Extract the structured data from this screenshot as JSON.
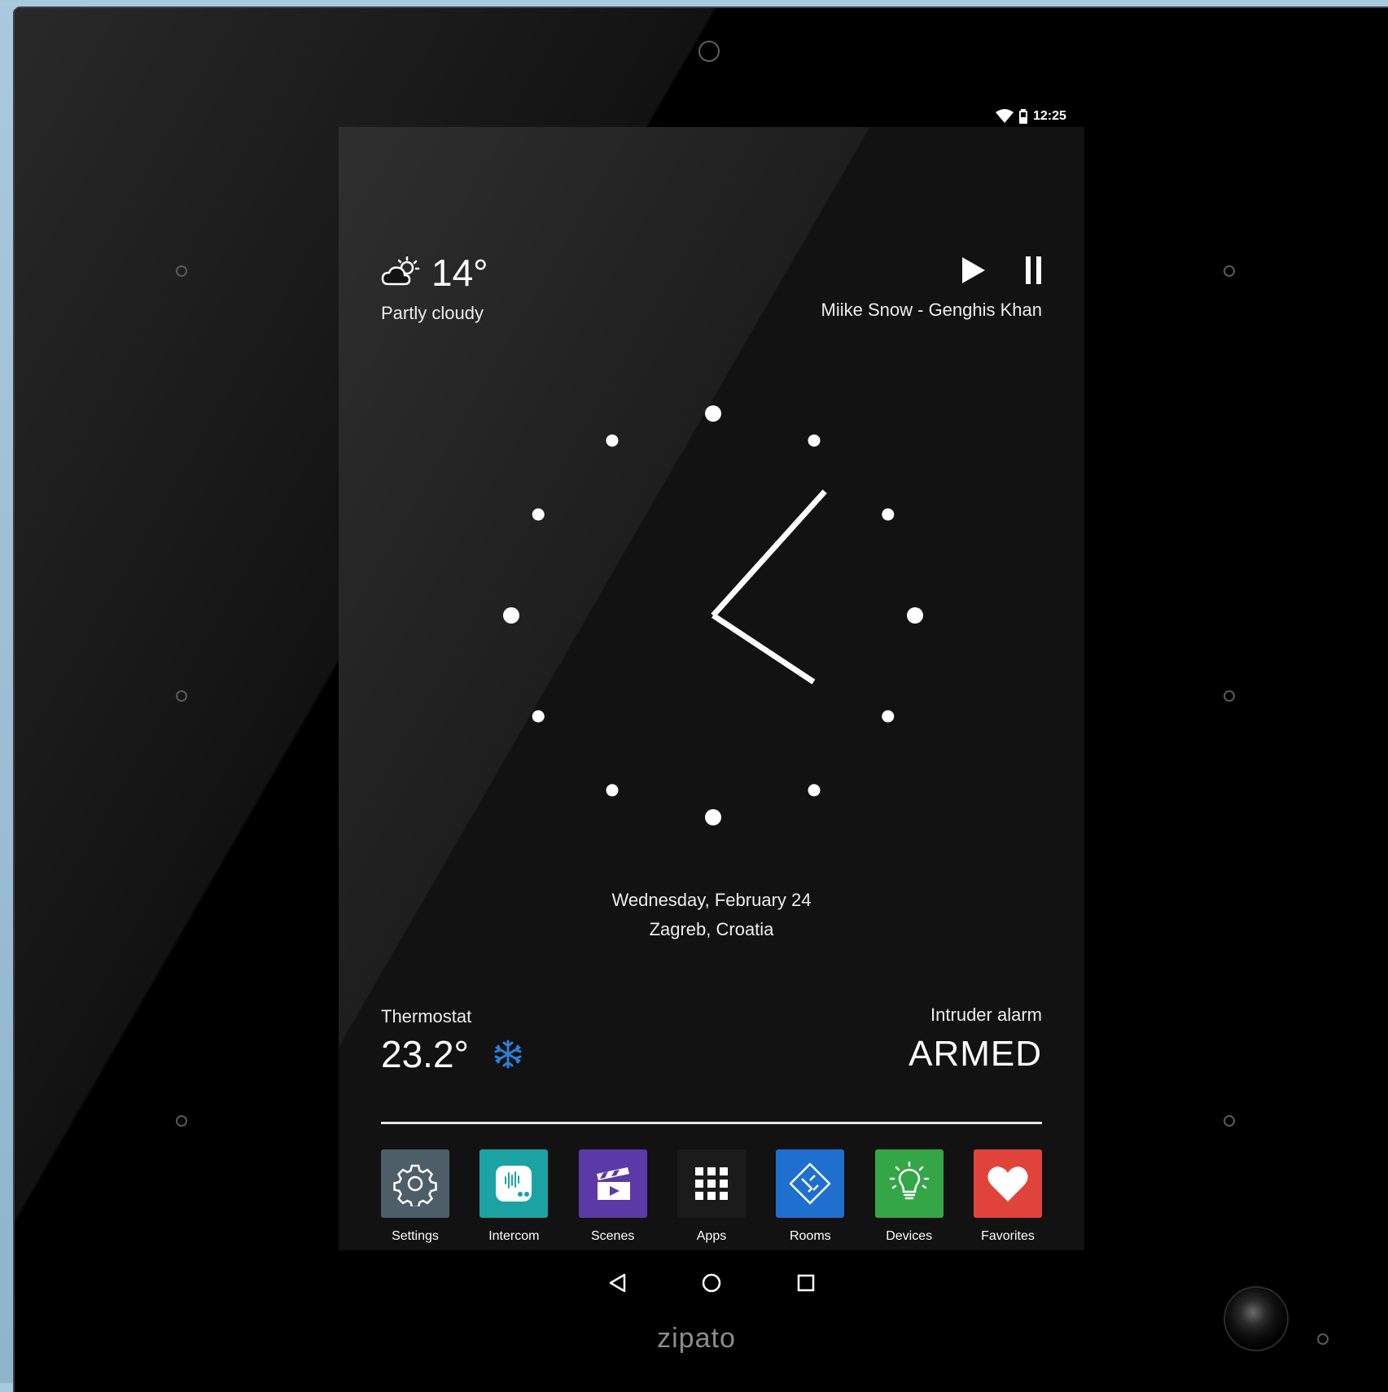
{
  "status_bar": {
    "time": "12:25",
    "icons": [
      "wifi-icon",
      "battery-icon"
    ]
  },
  "weather": {
    "temperature": "14°",
    "condition": "Partly cloudy",
    "icon": "partly-cloudy-icon"
  },
  "media": {
    "track": "Miike Snow - Genghis Khan",
    "play_icon": "play-icon",
    "pause_icon": "pause-icon"
  },
  "clock": {
    "hour": 4,
    "minute": 7,
    "hour_markers": 12
  },
  "date": {
    "day": "Wednesday, February 24",
    "location": "Zagreb, Croatia"
  },
  "thermostat": {
    "label": "Thermostat",
    "value": "23.2°",
    "mode_icon": "snowflake-icon",
    "mode_color": "#2e7fd6"
  },
  "alarm": {
    "label": "Intruder alarm",
    "state": "ARMED"
  },
  "dock": {
    "apps": [
      {
        "label": "Settings",
        "color": "#4d5e69",
        "icon": "gear-icon"
      },
      {
        "label": "Intercom",
        "color": "#1ba3a3",
        "icon": "intercom-icon"
      },
      {
        "label": "Scenes",
        "color": "#5b3aa7",
        "icon": "clapperboard-icon"
      },
      {
        "label": "Apps",
        "color": "#1b1b1b",
        "icon": "grid-icon"
      },
      {
        "label": "Rooms",
        "color": "#1f6fcf",
        "icon": "floorplan-icon"
      },
      {
        "label": "Devices",
        "color": "#35a647",
        "icon": "lightbulb-icon"
      },
      {
        "label": "Favorites",
        "color": "#e0433b",
        "icon": "heart-icon"
      }
    ]
  },
  "nav": {
    "back": "back-icon",
    "home": "home-icon",
    "recents": "recents-icon"
  },
  "brand": {
    "name": "zipato"
  }
}
